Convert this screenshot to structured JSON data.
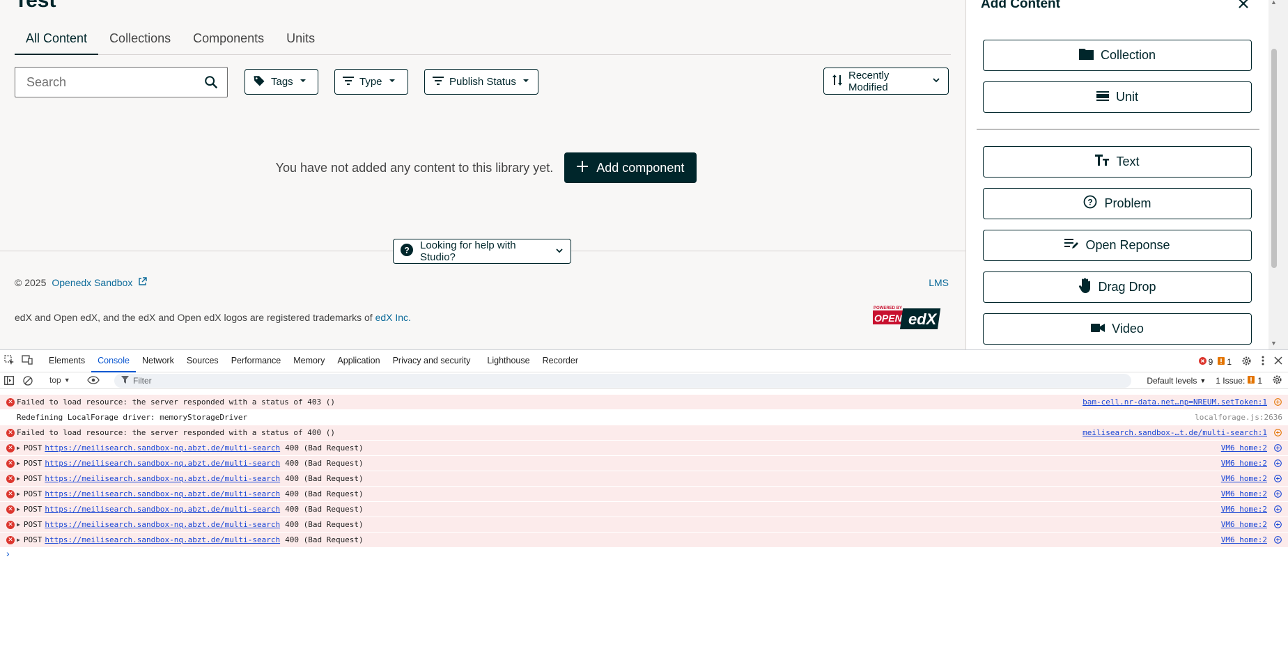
{
  "page": {
    "title": "Test",
    "tabs": [
      {
        "label": "All Content",
        "active": true
      },
      {
        "label": "Collections",
        "active": false
      },
      {
        "label": "Components",
        "active": false
      },
      {
        "label": "Units",
        "active": false
      }
    ],
    "search_placeholder": "Search",
    "filters": {
      "tags": "Tags",
      "type": "Type",
      "publish_status": "Publish Status",
      "sort": "Recently Modified"
    },
    "empty_message": "You have not added any content to this library yet.",
    "add_component": "Add component",
    "help": "Looking for help with Studio?",
    "footer": {
      "copyright": "© 2025",
      "site_link": "Openedx Sandbox",
      "lms": "LMS",
      "trademark_prefix": "edX and Open edX, and the edX and Open edX logos are registered trademarks of ",
      "trademark_link": "edX Inc.",
      "logo_powered": "POWERED BY",
      "logo_open": "OPEN",
      "logo_edx": "edX"
    }
  },
  "sidebar": {
    "title": "Add Content",
    "buttons": [
      "Collection",
      "Unit",
      "Text",
      "Problem",
      "Open Reponse",
      "Drag Drop",
      "Video"
    ]
  },
  "devtools": {
    "tabs": [
      "Elements",
      "Console",
      "Network",
      "Sources",
      "Performance",
      "Memory",
      "Application",
      "Privacy and security",
      "Lighthouse",
      "Recorder"
    ],
    "active_tab": "Console",
    "error_count": "9",
    "warning_count": "1",
    "context": "top",
    "filter_placeholder": "Filter",
    "levels": "Default levels",
    "issues_label": "1 Issue:",
    "issues_count": "1",
    "logs": [
      {
        "type": "err",
        "msg": "Failed to load resource: the server responded with a status of 403 ()",
        "src": "bam-cell.nr-data.net…np=NREUM.setToken:1"
      },
      {
        "type": "info",
        "msg": "Redefining LocalForage driver: memoryStorageDriver",
        "src": "localforage.js:2636"
      },
      {
        "type": "err",
        "msg": "Failed to load resource: the server responded with a status of 400 ()",
        "src": "meilisearch.sandbox-…t.de/multi-search:1"
      },
      {
        "type": "post",
        "method": "POST",
        "url": "https://meilisearch.sandbox-nq.abzt.de/multi-search",
        "status": "400 (Bad Request)",
        "src": "VM6 home:2"
      },
      {
        "type": "post",
        "method": "POST",
        "url": "https://meilisearch.sandbox-nq.abzt.de/multi-search",
        "status": "400 (Bad Request)",
        "src": "VM6 home:2"
      },
      {
        "type": "post",
        "method": "POST",
        "url": "https://meilisearch.sandbox-nq.abzt.de/multi-search",
        "status": "400 (Bad Request)",
        "src": "VM6 home:2"
      },
      {
        "type": "post",
        "method": "POST",
        "url": "https://meilisearch.sandbox-nq.abzt.de/multi-search",
        "status": "400 (Bad Request)",
        "src": "VM6 home:2"
      },
      {
        "type": "post",
        "method": "POST",
        "url": "https://meilisearch.sandbox-nq.abzt.de/multi-search",
        "status": "400 (Bad Request)",
        "src": "VM6 home:2"
      },
      {
        "type": "post",
        "method": "POST",
        "url": "https://meilisearch.sandbox-nq.abzt.de/multi-search",
        "status": "400 (Bad Request)",
        "src": "VM6 home:2"
      },
      {
        "type": "post",
        "method": "POST",
        "url": "https://meilisearch.sandbox-nq.abzt.de/multi-search",
        "status": "400 (Bad Request)",
        "src": "VM6 home:2"
      }
    ],
    "prompt": "›"
  },
  "colors": {
    "brand": "#00262b",
    "link": "#0d6b9a",
    "error": "#dc362e",
    "devtools_active": "#0b57d0"
  }
}
